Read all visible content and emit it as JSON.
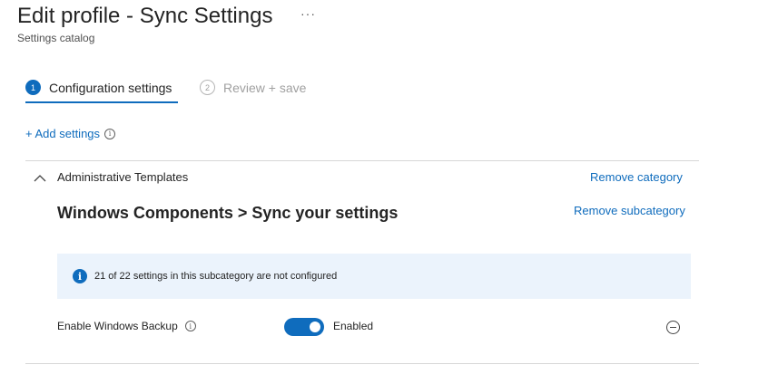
{
  "header": {
    "title": "Edit profile - Sync Settings",
    "more": "···",
    "subtitle": "Settings catalog"
  },
  "wizard": {
    "steps": [
      {
        "number": "1",
        "label": "Configuration settings",
        "state": "active"
      },
      {
        "number": "2",
        "label": "Review + save",
        "state": "inactive"
      }
    ]
  },
  "toolbar": {
    "add_settings": "+ Add settings",
    "info_glyph": "i"
  },
  "category": {
    "name": "Administrative Templates",
    "remove_label": "Remove category",
    "subcategory": {
      "title": "Windows Components > Sync your settings",
      "remove_label": "Remove subcategory",
      "info_message": "21 of 22 settings in this subcategory are not configured",
      "info_glyph": "i"
    },
    "settings": [
      {
        "label": "Enable Windows Backup",
        "info_glyph": "i",
        "enabled": true,
        "state_label": "Enabled"
      }
    ]
  },
  "colors": {
    "accent": "#0f6cbd",
    "info_background": "#ebf3fc",
    "divider": "#d6d6d6"
  },
  "icons": [
    "more-icon",
    "chevron-up-icon",
    "info-icon",
    "remove-circle-icon"
  ]
}
